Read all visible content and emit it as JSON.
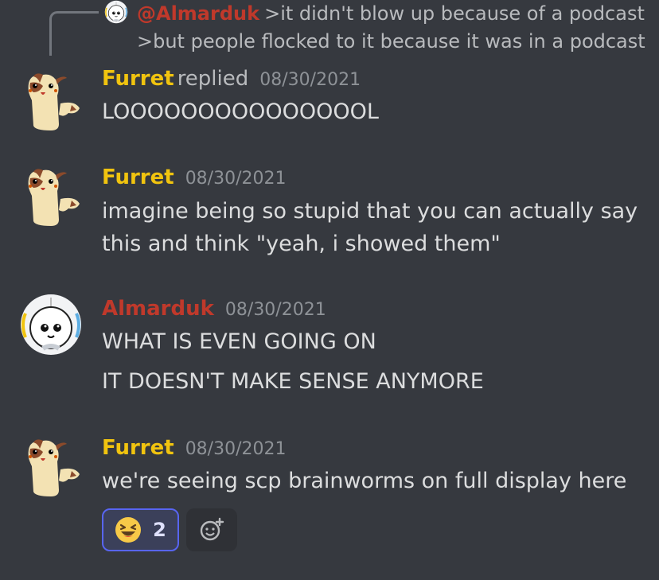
{
  "reply_preview": {
    "mention": "@Almarduk",
    "line1": ">it didn't blow up because of a podcast",
    "line2": ">but people flocked to it because it was in a podcast",
    "avatar_icon": "almarduk-avatar-icon"
  },
  "messages": [
    {
      "author": "Furret",
      "replied_label": "replied",
      "timestamp": "08/30/2021",
      "lines": [
        "LOOOOOOOOOOOOOOOL"
      ],
      "avatar_icon": "furret-avatar-icon"
    },
    {
      "author": "Furret",
      "timestamp": "08/30/2021",
      "lines": [
        "imagine being so stupid that you can actually say",
        "this and think \"yeah, i showed them\""
      ],
      "avatar_icon": "furret-avatar-icon"
    },
    {
      "author": "Almarduk",
      "timestamp": "08/30/2021",
      "lines": [
        "WHAT IS EVEN GOING ON",
        "IT DOESN'T MAKE SENSE ANYMORE"
      ],
      "avatar_icon": "almarduk-avatar-icon"
    },
    {
      "author": "Furret",
      "timestamp": "08/30/2021",
      "lines": [
        "we're seeing scp brainworms on full display here"
      ],
      "avatar_icon": "furret-avatar-icon"
    }
  ],
  "reaction": {
    "emoji_icon": "laughing-emoji-icon",
    "count": "2"
  },
  "add_reaction_icon": "add-reaction-icon",
  "colors": {
    "background": "#36393f",
    "furret_name": "#f1c40f",
    "almarduk_name": "#c0392b",
    "reaction_border": "#5865f2",
    "reaction_bg": "#3b405a"
  }
}
